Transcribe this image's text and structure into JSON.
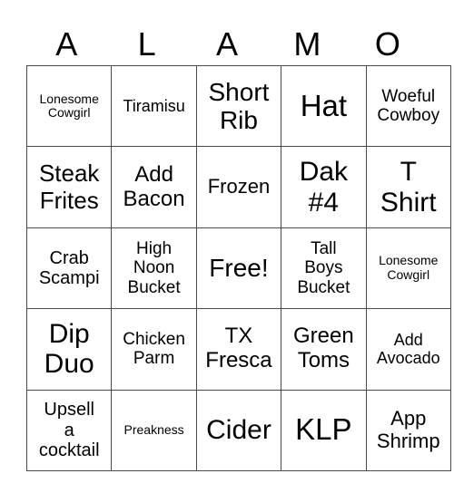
{
  "title_letters": [
    "A",
    "L",
    "A",
    "M",
    "O"
  ],
  "rows": [
    [
      "Lonesome\nCowgirl",
      "Tiramisu",
      "Short\nRib",
      "Hat",
      "Woeful\nCowboy"
    ],
    [
      "Steak\nFrites",
      "Add\nBacon",
      "Frozen",
      "Dak\n#4",
      "T\nShirt"
    ],
    [
      "Crab\nScampi",
      "High\nNoon\nBucket",
      "Free!",
      "Tall\nBoys\nBucket",
      "Lonesome\nCowgirl"
    ],
    [
      "Dip\nDuo",
      "Chicken\nParm",
      "TX\nFresca",
      "Green\nToms",
      "Add\nAvocado"
    ],
    [
      "Upsell\na\ncocktail",
      "Preakness",
      "Cider",
      "KLP",
      "App\nShrimp"
    ]
  ]
}
